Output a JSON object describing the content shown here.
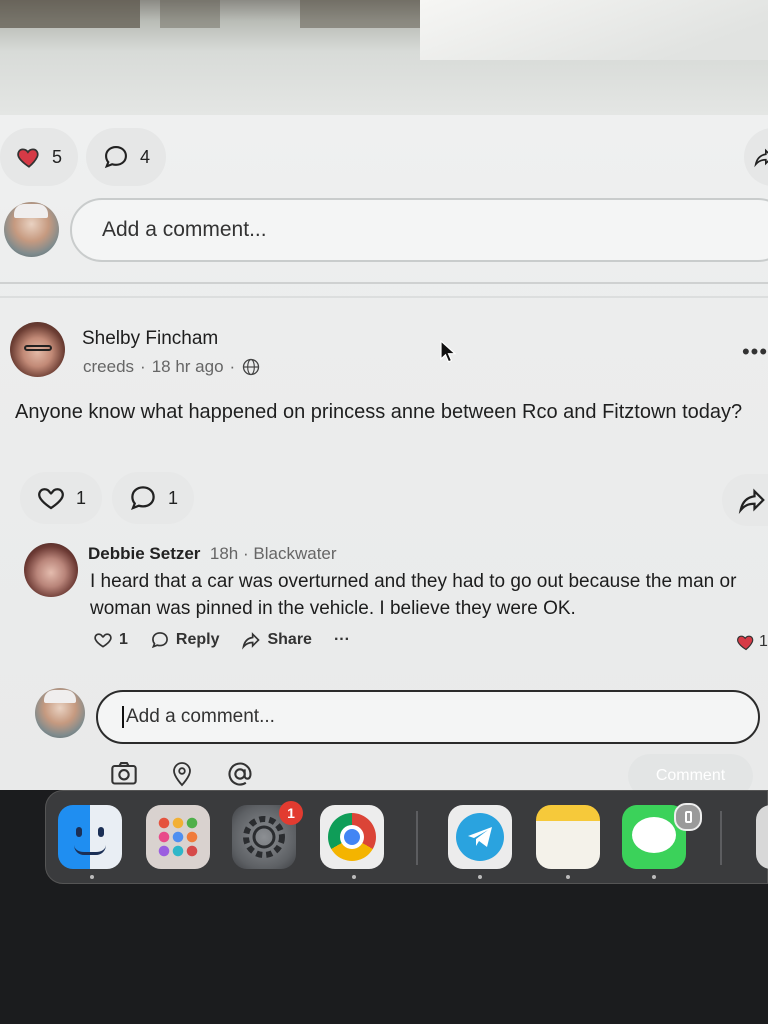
{
  "top_post": {
    "likes": "5",
    "comments": "4",
    "comment_placeholder": "Add a comment..."
  },
  "post": {
    "author": "Shelby Fincham",
    "group": "creeds",
    "time": "18 hr ago",
    "text": "Anyone know what happened on princess anne between Rco and Fitztown today?",
    "likes": "1",
    "comments": "1"
  },
  "reply": {
    "author": "Debbie Setzer",
    "time": "18h",
    "location": "Blackwater",
    "text": "I heard that a car was overturned and they had to go out because the man or woman was pinned in the vehicle. I believe they were OK.",
    "likes": "1",
    "reply_label": "Reply",
    "share_label": "Share",
    "more_label": "···",
    "reaction_count": "1"
  },
  "comment_box": {
    "placeholder": "Add a comment...",
    "button_label": "Comment"
  },
  "dock": {
    "apps": [
      "Finder",
      "Launchpad",
      "System Settings",
      "Google Chrome",
      "Telegram",
      "Notes",
      "Messages"
    ],
    "settings_badge": "1"
  },
  "colors": {
    "heart_red": "#d63a46",
    "accent": "#1e1e1e"
  }
}
